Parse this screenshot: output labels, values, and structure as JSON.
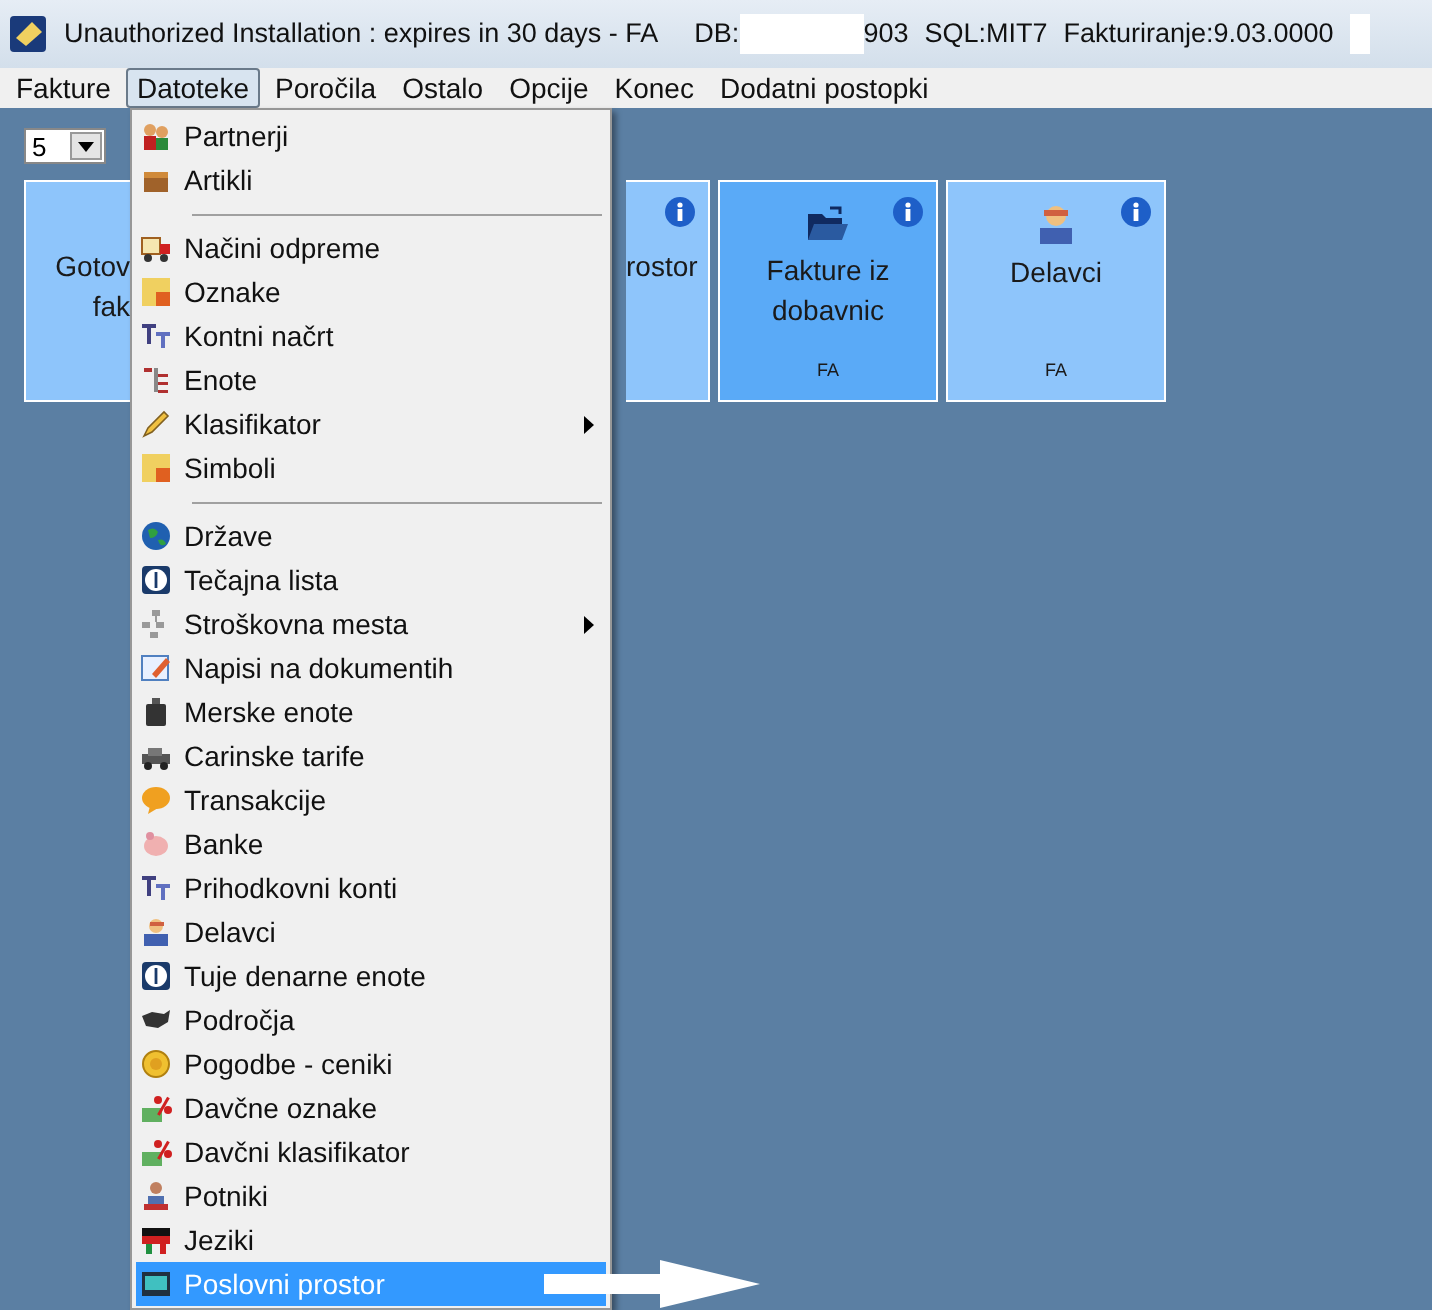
{
  "window": {
    "title": "Unauthorized Installation : expires in 30 days - FA",
    "db_label": "DB:",
    "db_suffix": "903",
    "sql": "SQL:MIT7",
    "version": "Fakturiranje:9.03.0000"
  },
  "menubar": [
    {
      "label": "Fakture",
      "selected": false
    },
    {
      "label": "Datoteke",
      "selected": true
    },
    {
      "label": "Poročila",
      "selected": false
    },
    {
      "label": "Ostalo",
      "selected": false
    },
    {
      "label": "Opcije",
      "selected": false
    },
    {
      "label": "Konec",
      "selected": false
    },
    {
      "label": "Dodatni postopki",
      "selected": false
    }
  ],
  "page_size": {
    "value": "5"
  },
  "tiles": [
    {
      "lines": [
        "Gotov",
        "fak"
      ],
      "info": false,
      "selected": false,
      "kind": "left"
    },
    {
      "lines": [
        "rostor"
      ],
      "info": true,
      "selected": false,
      "kind": "right"
    },
    {
      "lines": [
        "Fakture iz",
        "dobavnic"
      ],
      "code": "FA",
      "info": true,
      "selected": true,
      "kind": "full"
    },
    {
      "lines": [
        "Delavci"
      ],
      "code": "FA",
      "info": true,
      "selected": false,
      "kind": "full"
    }
  ],
  "menu": [
    {
      "kind": "item",
      "label": "Partnerji",
      "submenu": false,
      "selected": false
    },
    {
      "kind": "item",
      "label": "Artikli",
      "submenu": false,
      "selected": false
    },
    {
      "kind": "separator"
    },
    {
      "kind": "item",
      "label": "Načini odpreme",
      "submenu": false,
      "selected": false
    },
    {
      "kind": "item",
      "label": "Oznake",
      "submenu": false,
      "selected": false
    },
    {
      "kind": "item",
      "label": "Kontni načrt",
      "submenu": false,
      "selected": false
    },
    {
      "kind": "item",
      "label": "Enote",
      "submenu": false,
      "selected": false
    },
    {
      "kind": "item",
      "label": "Klasifikator",
      "submenu": true,
      "selected": false
    },
    {
      "kind": "item",
      "label": "Simboli",
      "submenu": false,
      "selected": false
    },
    {
      "kind": "separator"
    },
    {
      "kind": "item",
      "label": "Države",
      "submenu": false,
      "selected": false
    },
    {
      "kind": "item",
      "label": "Tečajna lista",
      "submenu": false,
      "selected": false
    },
    {
      "kind": "item",
      "label": "Stroškovna mesta",
      "submenu": true,
      "selected": false
    },
    {
      "kind": "item",
      "label": "Napisi na dokumentih",
      "submenu": false,
      "selected": false
    },
    {
      "kind": "item",
      "label": "Merske enote",
      "submenu": false,
      "selected": false
    },
    {
      "kind": "item",
      "label": "Carinske tarife",
      "submenu": false,
      "selected": false
    },
    {
      "kind": "item",
      "label": "Transakcije",
      "submenu": false,
      "selected": false
    },
    {
      "kind": "item",
      "label": "Banke",
      "submenu": false,
      "selected": false
    },
    {
      "kind": "item",
      "label": "Prihodkovni konti",
      "submenu": false,
      "selected": false
    },
    {
      "kind": "item",
      "label": "Delavci",
      "submenu": false,
      "selected": false
    },
    {
      "kind": "item",
      "label": "Tuje denarne enote",
      "submenu": false,
      "selected": false
    },
    {
      "kind": "item",
      "label": "Področja",
      "submenu": false,
      "selected": false
    },
    {
      "kind": "item",
      "label": "Pogodbe - ceniki",
      "submenu": false,
      "selected": false
    },
    {
      "kind": "item",
      "label": "Davčne oznake",
      "submenu": false,
      "selected": false
    },
    {
      "kind": "item",
      "label": "Davčni klasifikator",
      "submenu": false,
      "selected": false
    },
    {
      "kind": "item",
      "label": "Potniki",
      "submenu": false,
      "selected": false
    },
    {
      "kind": "item",
      "label": "Jeziki",
      "submenu": false,
      "selected": false
    },
    {
      "kind": "item",
      "label": "Poslovni prostor",
      "submenu": false,
      "selected": true
    }
  ]
}
